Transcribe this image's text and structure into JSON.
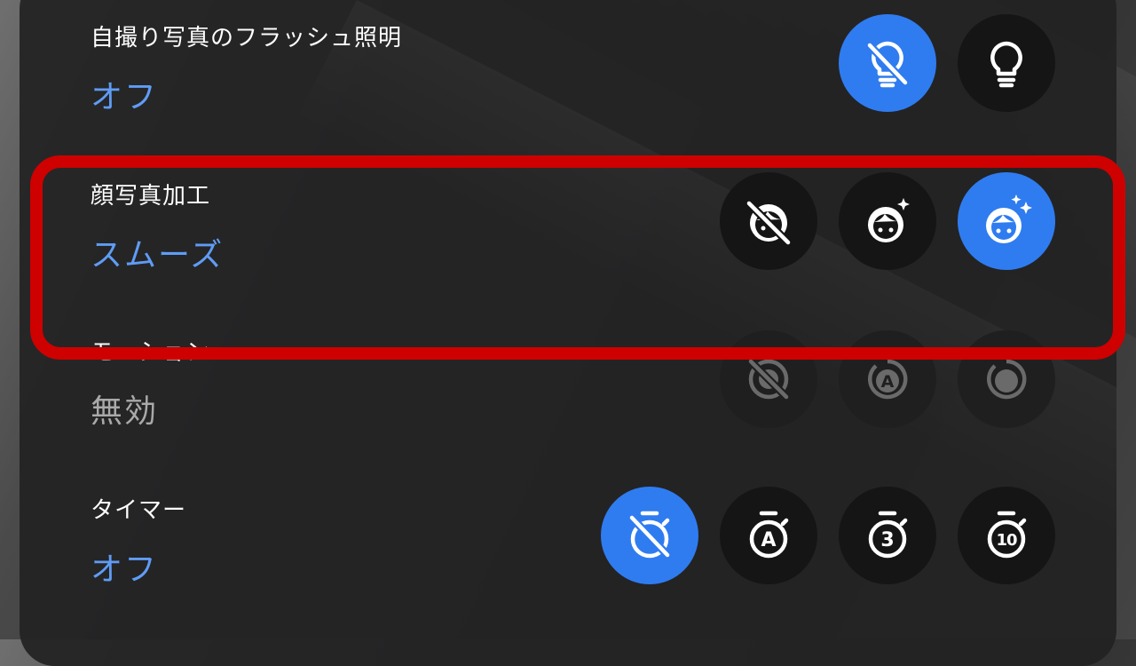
{
  "settings": {
    "flash": {
      "title": "自撮り写真のフラッシュ照明",
      "value": "オフ",
      "options": [
        {
          "icon": "flash-off-bulb-icon",
          "selected": true
        },
        {
          "icon": "flash-on-bulb-icon",
          "selected": false
        }
      ]
    },
    "face_retouch": {
      "title": "顔写真加工",
      "value": "スムーズ",
      "options": [
        {
          "icon": "face-retouch-off-icon",
          "selected": false
        },
        {
          "icon": "face-retouch-natural-icon",
          "selected": false
        },
        {
          "icon": "face-retouch-smooth-icon",
          "selected": true
        }
      ]
    },
    "motion": {
      "title": "モーション",
      "value": "無効",
      "enabled": false,
      "options": [
        {
          "icon": "motion-off-icon"
        },
        {
          "icon": "motion-auto-icon"
        },
        {
          "icon": "motion-on-icon"
        }
      ]
    },
    "timer": {
      "title": "タイマー",
      "value": "オフ",
      "options": [
        {
          "icon": "timer-off-icon",
          "selected": true
        },
        {
          "icon": "timer-auto-icon",
          "label": "A",
          "selected": false
        },
        {
          "icon": "timer-3s-icon",
          "label": "3",
          "selected": false
        },
        {
          "icon": "timer-10s-icon",
          "label": "10",
          "selected": false
        }
      ]
    }
  },
  "colors": {
    "accent": "#2f7cf0",
    "value_blue": "#5f9cf5",
    "highlight_red": "#cf0000",
    "panel": "#222223"
  }
}
